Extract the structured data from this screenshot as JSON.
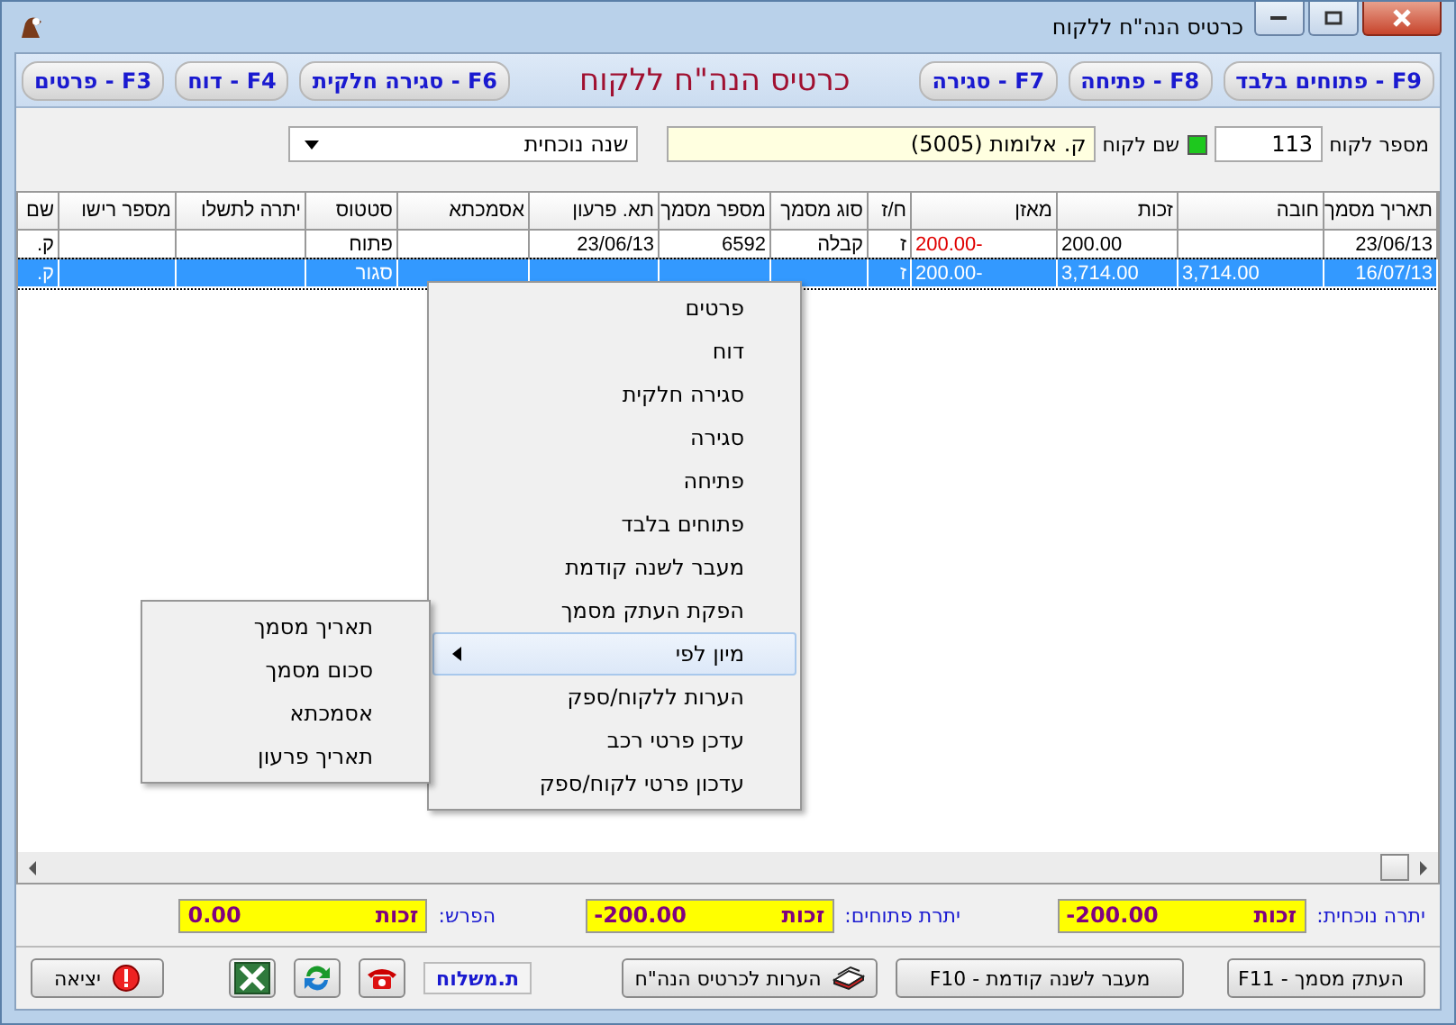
{
  "window": {
    "title": "כרטיס הנה\"ח ללקוח"
  },
  "toolbar": {
    "buttons": [
      {
        "label": "F9 - פתוחים בלבד"
      },
      {
        "label": "F8 - פתיחה"
      },
      {
        "label": "F7 - סגירה"
      }
    ],
    "heading": "כרטיס הנה\"ח ללקוח",
    "buttons_left": [
      {
        "label": "F6 - סגירה חלקית"
      },
      {
        "label": "F4 - דוח"
      },
      {
        "label": "F3 - פרטים"
      }
    ]
  },
  "customer": {
    "number_label": "מספר לקוח",
    "number": "113",
    "name_label": "שם לקוח",
    "name": "ק. אלומות (5005)",
    "year": "שנה נוכחית"
  },
  "table": {
    "columns": [
      "תאריך מסמך",
      "חובה",
      "זכות",
      "מאזן",
      "ח/ז",
      "סוג מסמך",
      "מספר מסמך",
      "תא. פרעון",
      "אסמכתא",
      "סטטוס",
      "יתרה לתשלו",
      "מספר רישו",
      "שם"
    ],
    "rows": [
      {
        "selected": false,
        "negative": true,
        "cells": [
          "23/06/13",
          "",
          "200.00",
          "200.00-",
          "ז",
          "קבלה",
          "6592",
          "23/06/13",
          "",
          "פתוח",
          "",
          "",
          "ק."
        ]
      },
      {
        "selected": true,
        "negative": true,
        "cells": [
          "16/07/13",
          "3,714.00",
          "3,714.00",
          "200.00-",
          "ז",
          "",
          "",
          "",
          "",
          "סגור",
          "",
          "",
          "ק."
        ]
      }
    ]
  },
  "context_menu": {
    "items": [
      {
        "label": "פרטים",
        "selected": false
      },
      {
        "label": "דוח",
        "selected": false
      },
      {
        "label": "סגירה חלקית",
        "selected": false
      },
      {
        "label": "סגירה",
        "selected": false
      },
      {
        "label": "פתיחה",
        "selected": false
      },
      {
        "label": "פתוחים בלבד",
        "selected": false
      },
      {
        "label": "מעבר לשנה קודמת",
        "selected": false
      },
      {
        "label": "הפקת העתק מסמך",
        "selected": false
      },
      {
        "label": "מיון לפי",
        "selected": true,
        "submenu": [
          "תאריך מסמך",
          "סכום מסמך",
          "אסמכתא",
          "תאריך פרעון"
        ]
      },
      {
        "label": "הערות ללקוח/ספק",
        "selected": false
      },
      {
        "label": "עדכן פרטי רכב",
        "selected": false
      },
      {
        "label": "עדכון פרטי לקוח/ספק",
        "selected": false
      }
    ]
  },
  "totals": [
    {
      "label": "יתרה נוכחית:",
      "value": "-200.00",
      "side": "זכות"
    },
    {
      "label": "יתרת פתוחים:",
      "value": "-200.00",
      "side": "זכות"
    },
    {
      "label": "הפרש:",
      "value": "0.00",
      "side": "זכות"
    }
  ],
  "buttons": [
    {
      "kind": "print",
      "label": "העתק מסמך - F11"
    },
    {
      "kind": "plain",
      "label": "מעבר לשנה קודמת - F10"
    },
    {
      "kind": "notes",
      "label": "הערות לכרטיס הנה\"ח"
    },
    {
      "kind": "link",
      "label": "ת.משלוח"
    },
    {
      "kind": "phone"
    },
    {
      "kind": "refresh"
    },
    {
      "kind": "excel"
    },
    {
      "kind": "exit",
      "label": "יציאה"
    }
  ]
}
